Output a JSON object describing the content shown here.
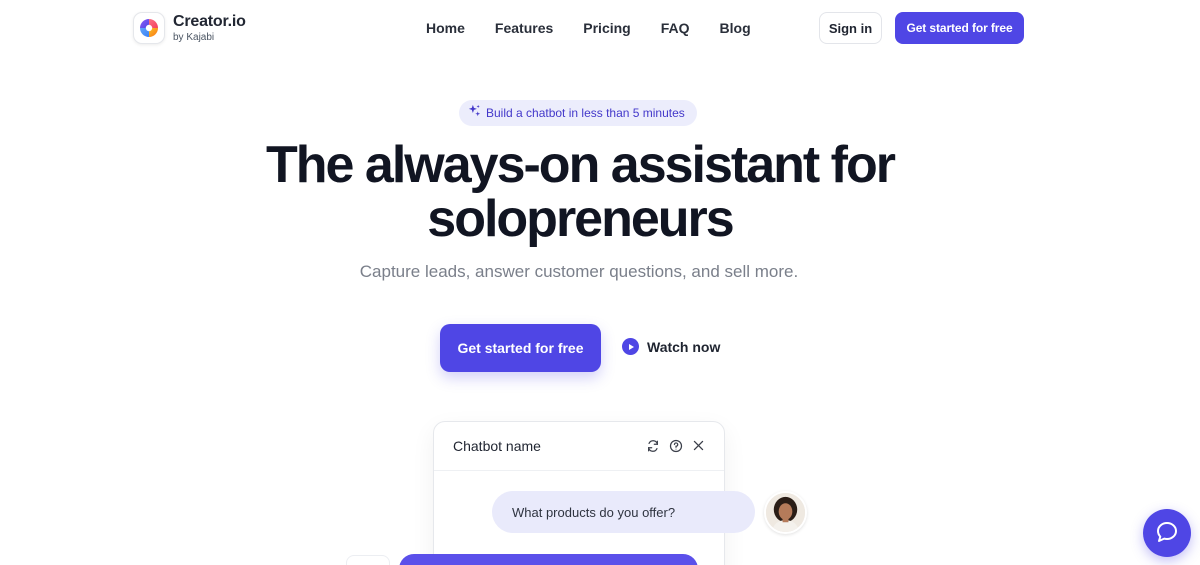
{
  "brand": {
    "name": "Creator.io",
    "sub": "by Kajabi",
    "logo_icon": "creator-logo-icon",
    "accent": "#4f46e5"
  },
  "nav": {
    "items": [
      {
        "label": "Home"
      },
      {
        "label": "Features"
      },
      {
        "label": "Pricing"
      },
      {
        "label": "FAQ"
      },
      {
        "label": "Blog"
      }
    ],
    "sign_in": "Sign in",
    "cta": "Get started for free"
  },
  "hero": {
    "badge": "Build a chatbot in less than 5 minutes",
    "badge_icon": "sparkles-icon",
    "headline_line1": "The always-on assistant for",
    "headline_line2": "solopreneurs",
    "subheadline": "Capture leads, answer customer questions, and sell more.",
    "cta": "Get started for free",
    "watch": "Watch now",
    "watch_icon": "play-icon"
  },
  "chat_widget": {
    "title": "Chatbot name",
    "tool_icons": [
      "refresh-icon",
      "help-icon",
      "close-icon"
    ],
    "user_message": "What products do you offer?"
  },
  "help_launcher": {
    "icon": "chat-bubble-icon"
  }
}
